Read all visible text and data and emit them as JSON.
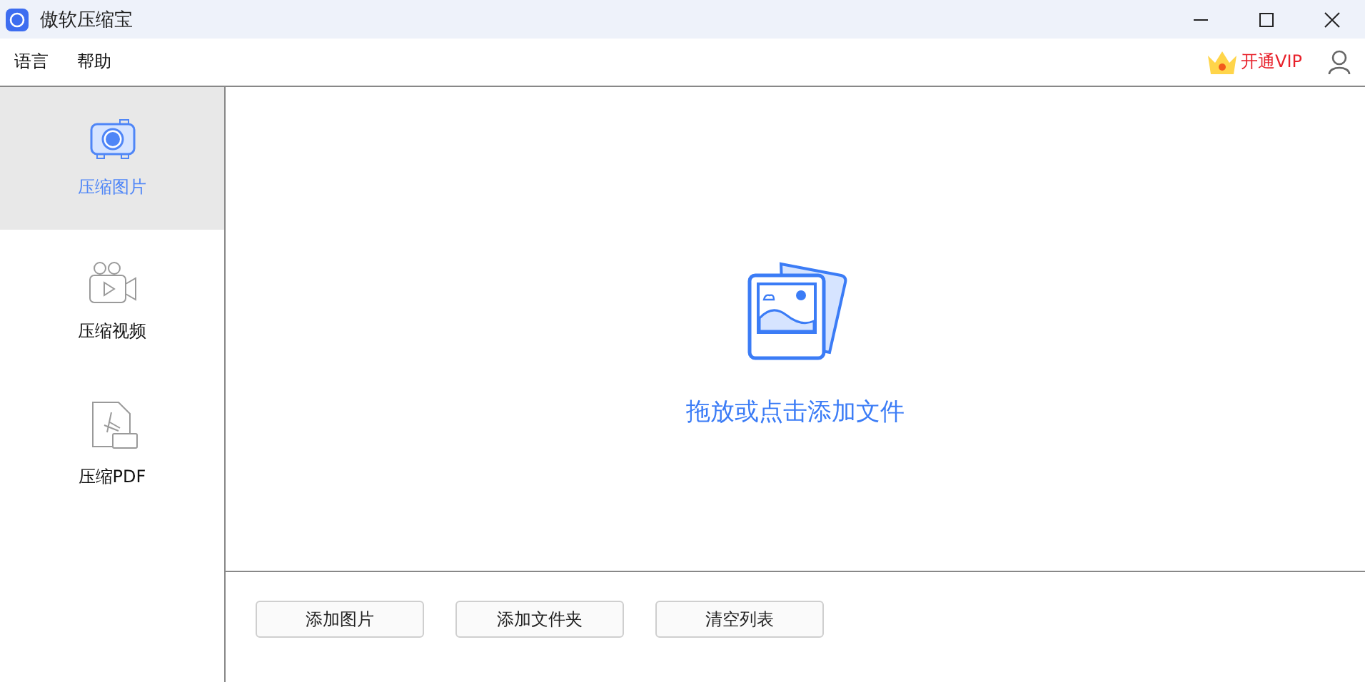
{
  "window": {
    "title": "傲软压缩宝"
  },
  "menu": [
    "语言",
    "帮助"
  ],
  "vip": {
    "label": "开通VIP"
  },
  "sidebar": {
    "items": [
      {
        "kind": "image",
        "label": "压缩图片",
        "selected": true
      },
      {
        "kind": "video",
        "label": "压缩视频",
        "selected": false
      },
      {
        "kind": "pdf",
        "label": "压缩PDF",
        "selected": false
      }
    ]
  },
  "dropzone": {
    "hint": "拖放或点击添加文件"
  },
  "buttons": [
    "添加图片",
    "添加文件夹",
    "清空列表"
  ]
}
